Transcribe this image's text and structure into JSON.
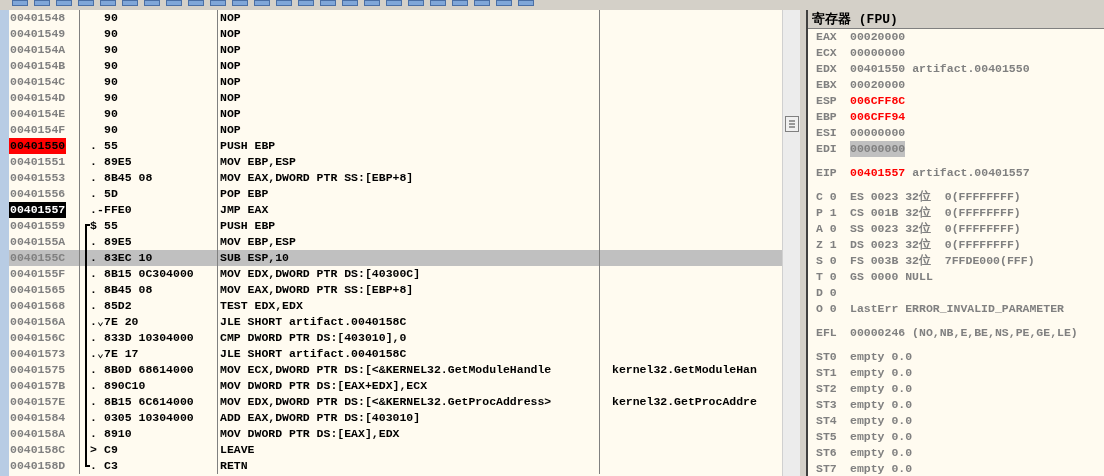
{
  "disassembly": {
    "rows": [
      {
        "address": "00401548",
        "hex": "90",
        "instruction": "NOP",
        "breakpoint": false,
        "current": false,
        "selected": false,
        "bracket": false
      },
      {
        "address": "00401549",
        "hex": "90",
        "instruction": "NOP",
        "breakpoint": false,
        "current": false,
        "selected": false,
        "bracket": false
      },
      {
        "address": "0040154A",
        "hex": "90",
        "instruction": "NOP",
        "breakpoint": false,
        "current": false,
        "selected": false,
        "bracket": false
      },
      {
        "address": "0040154B",
        "hex": "90",
        "instruction": "NOP",
        "breakpoint": false,
        "current": false,
        "selected": false,
        "bracket": false
      },
      {
        "address": "0040154C",
        "hex": "90",
        "instruction": "NOP",
        "breakpoint": false,
        "current": false,
        "selected": false,
        "bracket": false
      },
      {
        "address": "0040154D",
        "hex": "90",
        "instruction": "NOP",
        "breakpoint": false,
        "current": false,
        "selected": false,
        "bracket": false
      },
      {
        "address": "0040154E",
        "hex": "90",
        "instruction": "NOP",
        "breakpoint": false,
        "current": false,
        "selected": false,
        "bracket": false
      },
      {
        "address": "0040154F",
        "hex": "90",
        "instruction": "NOP",
        "breakpoint": false,
        "current": false,
        "selected": false,
        "bracket": false
      },
      {
        "address": "00401550",
        "prefix": ".",
        "hex": "55",
        "instruction": "PUSH EBP",
        "breakpoint": true,
        "current": false,
        "selected": false,
        "bracket": false
      },
      {
        "address": "00401551",
        "prefix": ".",
        "hex": "89E5",
        "instruction": "MOV EBP,ESP",
        "breakpoint": false,
        "current": false,
        "selected": false,
        "bracket": false
      },
      {
        "address": "00401553",
        "prefix": ".",
        "hex": "8B45 08",
        "instruction": "MOV EAX,DWORD PTR SS:[EBP+8]",
        "breakpoint": false,
        "current": false,
        "selected": false,
        "bracket": false
      },
      {
        "address": "00401556",
        "prefix": ".",
        "hex": "5D",
        "instruction": "POP EBP",
        "breakpoint": false,
        "current": false,
        "selected": false,
        "bracket": false
      },
      {
        "address": "00401557",
        "prefix": ".-",
        "hex": "FFE0",
        "instruction": "JMP EAX",
        "breakpoint": false,
        "current": true,
        "selected": false,
        "bracket": false
      },
      {
        "address": "00401559",
        "prefix": "$",
        "hex": "55",
        "instruction": "PUSH EBP",
        "breakpoint": false,
        "current": false,
        "selected": false,
        "bracket": true
      },
      {
        "address": "0040155A",
        "prefix": ".",
        "hex": "89E5",
        "instruction": "MOV EBP,ESP",
        "breakpoint": false,
        "current": false,
        "selected": false,
        "bracket": true
      },
      {
        "address": "0040155C",
        "prefix": ".",
        "hex": "83EC 10",
        "instruction": "SUB ESP,10",
        "breakpoint": false,
        "current": false,
        "selected": true,
        "bracket": true
      },
      {
        "address": "0040155F",
        "prefix": ".",
        "hex": "8B15 0C304000",
        "instruction": "MOV EDX,DWORD PTR DS:[40300C]",
        "breakpoint": false,
        "current": false,
        "selected": false,
        "bracket": true
      },
      {
        "address": "00401565",
        "prefix": ".",
        "hex": "8B45 08",
        "instruction": "MOV EAX,DWORD PTR SS:[EBP+8]",
        "breakpoint": false,
        "current": false,
        "selected": false,
        "bracket": true
      },
      {
        "address": "00401568",
        "prefix": ".",
        "hex": "85D2",
        "instruction": "TEST EDX,EDX",
        "breakpoint": false,
        "current": false,
        "selected": false,
        "bracket": true
      },
      {
        "address": "0040156A",
        "prefix": ".⌄",
        "hex": "7E 20",
        "instruction": "JLE SHORT artifact.0040158C",
        "breakpoint": false,
        "current": false,
        "selected": false,
        "bracket": true
      },
      {
        "address": "0040156C",
        "prefix": ".",
        "hex": "833D 10304000",
        "instruction": "CMP DWORD PTR DS:[403010],0",
        "breakpoint": false,
        "current": false,
        "selected": false,
        "bracket": true
      },
      {
        "address": "00401573",
        "prefix": ".⌄",
        "hex": "7E 17",
        "instruction": "JLE SHORT artifact.0040158C",
        "breakpoint": false,
        "current": false,
        "selected": false,
        "bracket": true
      },
      {
        "address": "00401575",
        "prefix": ".",
        "hex": "8B0D 68614000",
        "instruction": "MOV ECX,DWORD PTR DS:[<&KERNEL32.GetModuleHandle",
        "comment": "kernel32.GetModuleHan",
        "breakpoint": false,
        "current": false,
        "selected": false,
        "bracket": true
      },
      {
        "address": "0040157B",
        "prefix": ".",
        "hex": "890C10",
        "instruction": "MOV DWORD PTR DS:[EAX+EDX],ECX",
        "breakpoint": false,
        "current": false,
        "selected": false,
        "bracket": true
      },
      {
        "address": "0040157E",
        "prefix": ".",
        "hex": "8B15 6C614000",
        "instruction": "MOV EDX,DWORD PTR DS:[<&KERNEL32.GetProcAddress>",
        "comment": "kernel32.GetProcAddre",
        "breakpoint": false,
        "current": false,
        "selected": false,
        "bracket": true
      },
      {
        "address": "00401584",
        "prefix": ".",
        "hex": "0305 10304000",
        "instruction": "ADD EAX,DWORD PTR DS:[403010]",
        "breakpoint": false,
        "current": false,
        "selected": false,
        "bracket": true
      },
      {
        "address": "0040158A",
        "prefix": ".",
        "hex": "8910",
        "instruction": "MOV DWORD PTR DS:[EAX],EDX",
        "breakpoint": false,
        "current": false,
        "selected": false,
        "bracket": true
      },
      {
        "address": "0040158C",
        "prefix": ">",
        "hex": "C9",
        "instruction": "LEAVE",
        "breakpoint": false,
        "current": false,
        "selected": false,
        "bracket": true
      },
      {
        "address": "0040158D",
        "prefix": ".",
        "hex": "C3",
        "instruction": "RETN",
        "breakpoint": false,
        "current": false,
        "selected": false,
        "bracket": true
      }
    ]
  },
  "registers": {
    "title": "寄存器 (FPU)",
    "groups": [
      [
        {
          "name": "EAX",
          "value": "00020000",
          "changed": false,
          "selected": false
        },
        {
          "name": "ECX",
          "value": "00000000",
          "changed": false,
          "selected": false
        },
        {
          "name": "EDX",
          "value": "00401550",
          "comment": "artifact.00401550",
          "changed": false,
          "selected": false
        },
        {
          "name": "EBX",
          "value": "00020000",
          "changed": false,
          "selected": false
        },
        {
          "name": "ESP",
          "value": "006CFF8C",
          "changed": true,
          "selected": false
        },
        {
          "name": "EBP",
          "value": "006CFF94",
          "changed": true,
          "selected": false
        },
        {
          "name": "ESI",
          "value": "00000000",
          "changed": false,
          "selected": false
        },
        {
          "name": "EDI",
          "value": "00000000",
          "changed": false,
          "selected": true
        }
      ],
      [
        {
          "name": "EIP",
          "value": "00401557",
          "comment": "artifact.00401557",
          "changed": true,
          "selected": false
        }
      ],
      [
        {
          "name": "C 0",
          "value": "ES 0023 32位  0(FFFFFFFF)",
          "changed": false,
          "selected": false
        },
        {
          "name": "P 1",
          "value": "CS 001B 32位  0(FFFFFFFF)",
          "changed": false,
          "selected": false
        },
        {
          "name": "A 0",
          "value": "SS 0023 32位  0(FFFFFFFF)",
          "changed": false,
          "selected": false
        },
        {
          "name": "Z 1",
          "value": "DS 0023 32位  0(FFFFFFFF)",
          "changed": false,
          "selected": false
        },
        {
          "name": "S 0",
          "value": "FS 003B 32位  7FFDE000(FFF)",
          "changed": false,
          "selected": false
        },
        {
          "name": "T 0",
          "value": "GS 0000 NULL",
          "changed": false,
          "selected": false
        },
        {
          "name": "D 0",
          "changed": false,
          "selected": false
        },
        {
          "name": "O 0",
          "value": "LastErr ERROR_INVALID_PARAMETER",
          "changed": false,
          "selected": false
        }
      ],
      [
        {
          "name": "EFL",
          "value": "00000246 (NO,NB,E,BE,NS,PE,GE,LE)",
          "changed": false,
          "selected": false
        }
      ],
      [
        {
          "name": "ST0",
          "value": "empty 0.0",
          "changed": false,
          "selected": false
        },
        {
          "name": "ST1",
          "value": "empty 0.0",
          "changed": false,
          "selected": false
        },
        {
          "name": "ST2",
          "value": "empty 0.0",
          "changed": false,
          "selected": false
        },
        {
          "name": "ST3",
          "value": "empty 0.0",
          "changed": false,
          "selected": false
        },
        {
          "name": "ST4",
          "value": "empty 0.0",
          "changed": false,
          "selected": false
        },
        {
          "name": "ST5",
          "value": "empty 0.0",
          "changed": false,
          "selected": false
        },
        {
          "name": "ST6",
          "value": "empty 0.0",
          "changed": false,
          "selected": false
        },
        {
          "name": "ST7",
          "value": "empty 0.0",
          "changed": false,
          "selected": false
        }
      ]
    ]
  }
}
